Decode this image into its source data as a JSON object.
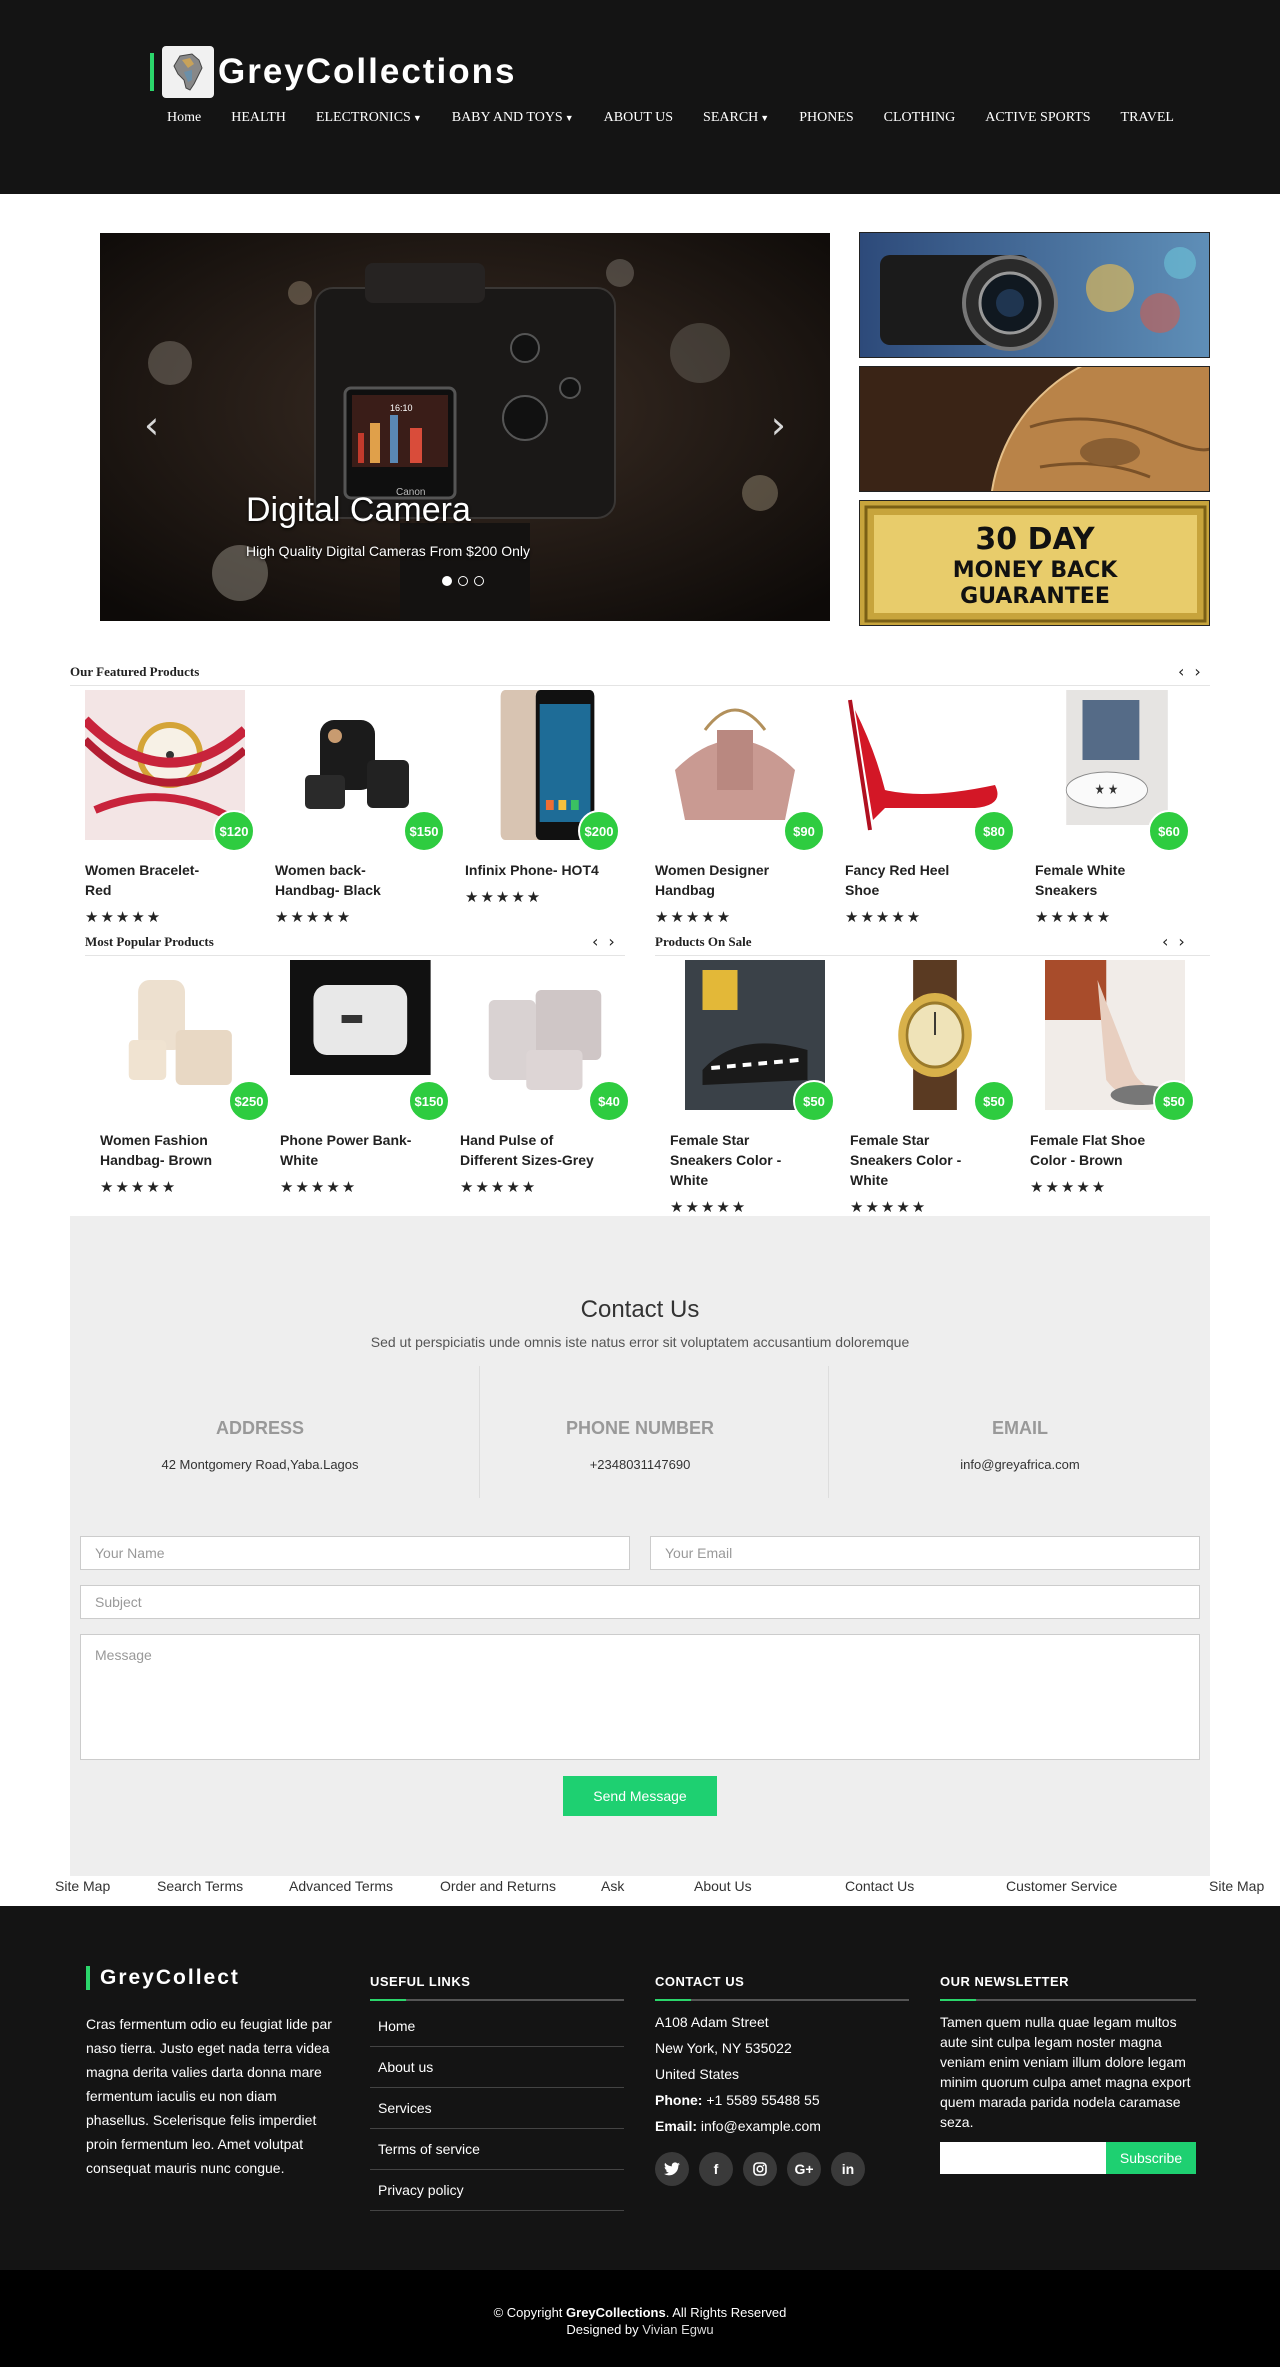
{
  "header": {
    "brand": "GreyCollections",
    "nav": [
      {
        "label": "Home",
        "caret": false
      },
      {
        "label": "HEALTH",
        "caret": false
      },
      {
        "label": "ELECTRONICS",
        "caret": true
      },
      {
        "label": "BABY AND TOYS",
        "caret": true
      },
      {
        "label": "ABOUT US",
        "caret": false
      },
      {
        "label": "SEARCH",
        "caret": true
      },
      {
        "label": "PHONES",
        "caret": false
      },
      {
        "label": "CLOTHING",
        "caret": false
      },
      {
        "label": "ACTIVE SPORTS",
        "caret": false
      },
      {
        "label": "TRAVEL",
        "caret": false
      }
    ]
  },
  "carousel": {
    "title": "Digital Camera",
    "subtitle": "High Quality Digital Cameras From $200 Only",
    "prev_icon": "chevron-left-icon",
    "next_icon": "chevron-right-icon",
    "slide_count": 3,
    "active": 0,
    "camera_brand": "Canon",
    "screen_time": "16:10"
  },
  "side_banners": {
    "guarantee_line1": "30 DAY",
    "guarantee_line2": "MONEY BACK",
    "guarantee_line3": "GUARANTEE"
  },
  "featured": {
    "title": "Our Featured Products",
    "items": [
      {
        "name": "Women Bracelet-Red",
        "price": "$120",
        "stars": "★★★★★"
      },
      {
        "name": "Women back-Handbag- Black",
        "price": "$150",
        "stars": "★★★★★"
      },
      {
        "name": "Infinix Phone- HOT4",
        "price": "$200",
        "stars": "★★★★★"
      },
      {
        "name": "Women Designer Handbag",
        "price": "$90",
        "stars": "★★★★★"
      },
      {
        "name": "Fancy Red Heel Shoe",
        "price": "$80",
        "stars": "★★★★★"
      },
      {
        "name": "Female White Sneakers",
        "price": "$60",
        "stars": "★★★★★"
      }
    ]
  },
  "popular": {
    "title": "Most Popular Products",
    "items": [
      {
        "name": "Women Fashion Handbag- Brown",
        "price": "$250",
        "stars": "★★★★★"
      },
      {
        "name": "Phone Power Bank- White",
        "price": "$150",
        "stars": "★★★★★"
      },
      {
        "name": "Hand Pulse of Different Sizes-Grey",
        "price": "$40",
        "stars": "★★★★★"
      }
    ]
  },
  "on_sale": {
    "title": "Products On Sale",
    "items": [
      {
        "name": "Female Star Sneakers Color - White",
        "price": "$50",
        "stars": "★★★★★"
      },
      {
        "name": "Female Star Sneakers Color - White",
        "price": "$50",
        "stars": "★★★★★"
      },
      {
        "name": "Female Flat Shoe Color - Brown",
        "price": "$50",
        "stars": "★★★★★"
      }
    ]
  },
  "contact": {
    "title": "Contact Us",
    "subtitle": "Sed ut perspiciatis unde omnis iste natus error sit voluptatem accusantium doloremque",
    "address_label": "ADDRESS",
    "address_value": "42 Montgomery Road,Yaba.Lagos",
    "phone_label": "PHONE NUMBER",
    "phone_value": "+2348031147690",
    "email_label": "EMAIL",
    "email_value": "info@greyafrica.com",
    "name_placeholder": "Your Name",
    "email_placeholder": "Your Email",
    "subject_placeholder": "Subject",
    "message_placeholder": "Message",
    "send_label": "Send Message"
  },
  "link_row": [
    "Site Map",
    "Search Terms",
    "Advanced Terms",
    "Order and Returns",
    "Ask",
    "About Us",
    "Contact Us",
    "Customer Service",
    "Site Map"
  ],
  "footer": {
    "brand": "GreyCollect",
    "about": "Cras fermentum odio eu feugiat lide par naso tierra. Justo eget nada terra videa magna derita valies darta donna mare fermentum iaculis eu non diam phasellus. Scelerisque felis imperdiet proin fermentum leo. Amet volutpat consequat mauris nunc congue.",
    "useful_title": "USEFUL LINKS",
    "useful_links": [
      "Home",
      "About us",
      "Services",
      "Terms of service",
      "Privacy policy"
    ],
    "contact_title": "CONTACT US",
    "contact_street": "A108 Adam Street",
    "contact_city": "New York, NY 535022",
    "contact_country": "United States",
    "phone_label": "Phone:",
    "phone_value": "+1 5589 55488 55",
    "email_label": "Email:",
    "email_value": "info@example.com",
    "social": [
      "twitter-icon",
      "facebook-icon",
      "instagram-icon",
      "google-plus-icon",
      "linkedin-icon"
    ],
    "newsletter_title": "OUR NEWSLETTER",
    "newsletter_text": "Tamen quem nulla quae legam multos aute sint culpa legam noster magna veniam enim veniam illum dolore legam minim quorum culpa amet magna export quem marada parida nodela caramase seza.",
    "subscribe_label": "Subscribe"
  },
  "copyright": {
    "prefix": "© Copyright",
    "brand": "GreyCollections",
    "suffix": ". All Rights Reserved",
    "designed_by": "Designed by",
    "author": "Vivian Egwu"
  },
  "colors": {
    "accent": "#1ed071",
    "price_badge": "#2ecc40",
    "header_bg": "#141414"
  }
}
